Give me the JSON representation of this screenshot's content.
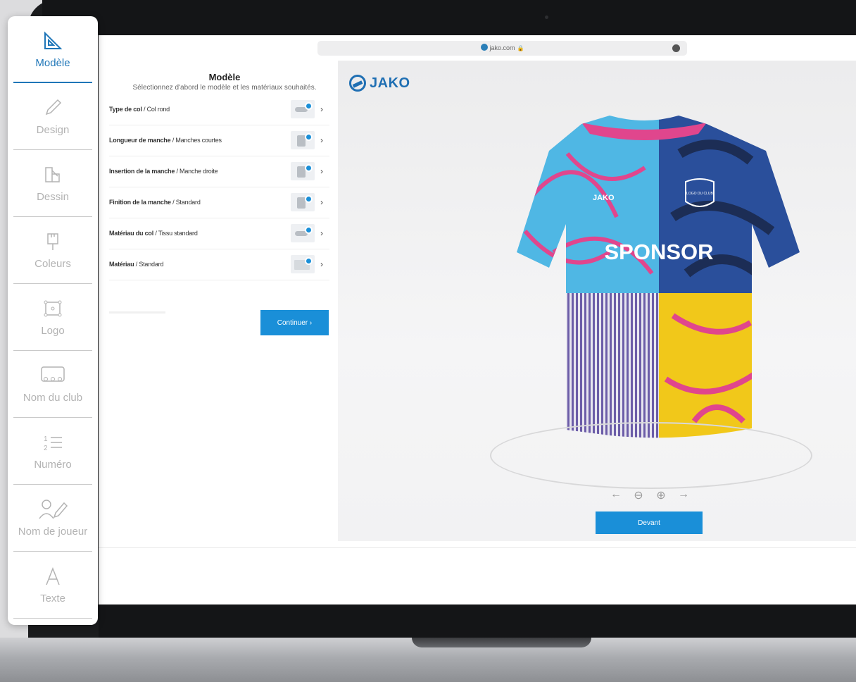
{
  "browser": {
    "url": "jako.com"
  },
  "sidebar": {
    "items": [
      {
        "label": "Modèle",
        "icon": "set-square-icon",
        "active": true
      },
      {
        "label": "Design",
        "icon": "pencil-icon"
      },
      {
        "label": "Dessin",
        "icon": "pattern-icon"
      },
      {
        "label": "Coleurs",
        "icon": "paint-brush-icon"
      },
      {
        "label": "Logo",
        "icon": "logo-frame-icon"
      },
      {
        "label": "Nom du club",
        "icon": "team-icon"
      },
      {
        "label": "Numéro",
        "icon": "numbered-list-icon"
      },
      {
        "label": "Nom de joueur",
        "icon": "player-edit-icon"
      },
      {
        "label": "Texte",
        "icon": "text-icon"
      }
    ]
  },
  "config": {
    "title": "Modèle",
    "subtitle": "Sélectionnez d'abord le modèle et les matériaux souhaités.",
    "options": [
      {
        "name": "Type de col",
        "value": "Col rond"
      },
      {
        "name": "Longueur de manche",
        "value": "Manches courtes"
      },
      {
        "name": "Insertion de la manche",
        "value": "Manche droite"
      },
      {
        "name": "Finition de la manche",
        "value": "Standard"
      },
      {
        "name": "Matériau du col",
        "value": "Tissu standard"
      },
      {
        "name": "Matériau",
        "value": "Standard"
      }
    ],
    "continue_label": "Continuer ›"
  },
  "preview": {
    "brand": "JAKO",
    "shirt_brand": "JAKO",
    "crest": "LOGO DU CLUB",
    "sponsor": "SPONSOR",
    "view_label": "Devant",
    "controls": [
      "←",
      "⊖",
      "⊕",
      "→"
    ]
  },
  "colors": {
    "accent": "#1a8fd8",
    "brand": "#1f6fb3",
    "shirt_cyan": "#4fb7e4",
    "shirt_navy": "#2a4f9b",
    "shirt_yellow": "#f1c81a",
    "shirt_pink": "#e0468d"
  }
}
